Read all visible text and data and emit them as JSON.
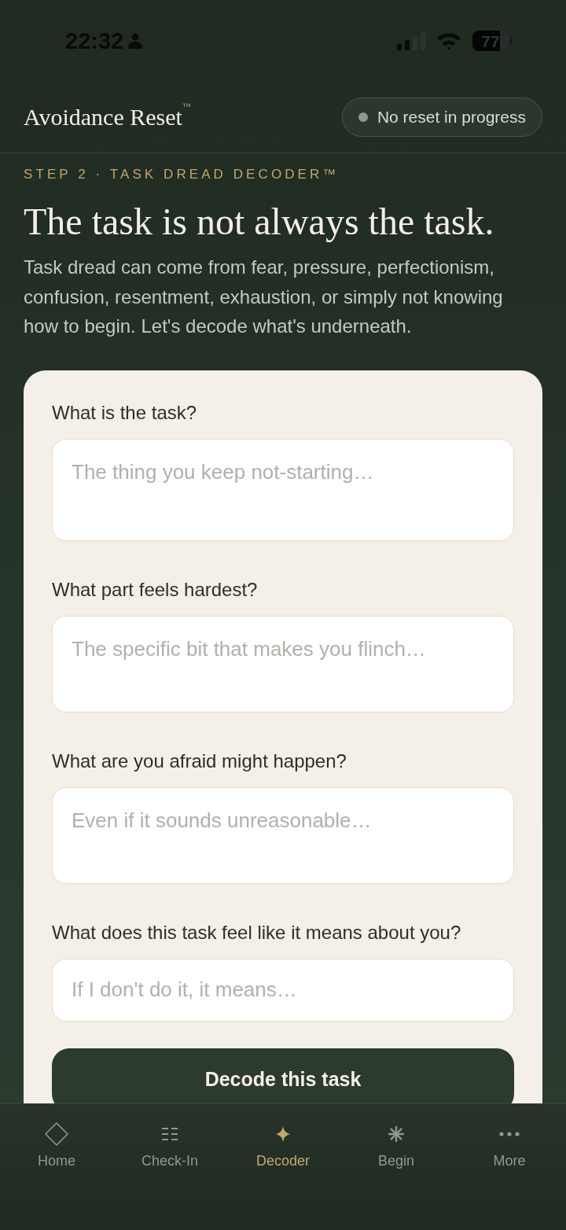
{
  "status_bar": {
    "time": "22:32",
    "battery": "77"
  },
  "header": {
    "brand": "Avoidance Reset$^{™}$",
    "status": "No reset in progress"
  },
  "intro": {
    "step": "STEP 2 · TASK DREAD DECODER™",
    "title": "The task is not always the task.",
    "description": "Task dread can come from fear, pressure, perfectionism, confusion, resentment, exhaustion, or simply not knowing how to begin. Let's decode what's underneath."
  },
  "form": {
    "fields": [
      {
        "kind": "textarea",
        "label": "What is the task?",
        "placeholder": "The thing you keep not-starting…"
      },
      {
        "kind": "textarea",
        "label": "What part feels hardest?",
        "placeholder": "The specific bit that makes you flinch…"
      },
      {
        "kind": "textarea",
        "label": "What are you afraid might happen?",
        "placeholder": "Even if it sounds unreasonable…"
      },
      {
        "kind": "input",
        "label": "What does this task feel like it means about you?",
        "placeholder": "If I don't do it, it means…"
      }
    ],
    "submit": "Decode this task"
  },
  "nav": [
    {
      "kind": "diamond",
      "label": "Home",
      "selected": false
    },
    {
      "kind": "lines",
      "label": "Check-In",
      "selected": false
    },
    {
      "kind": "sparkle",
      "label": "Decoder",
      "selected": true
    },
    {
      "kind": "asterisk",
      "label": "Begin",
      "selected": false
    },
    {
      "kind": "dots",
      "label": "More",
      "selected": false
    }
  ]
}
